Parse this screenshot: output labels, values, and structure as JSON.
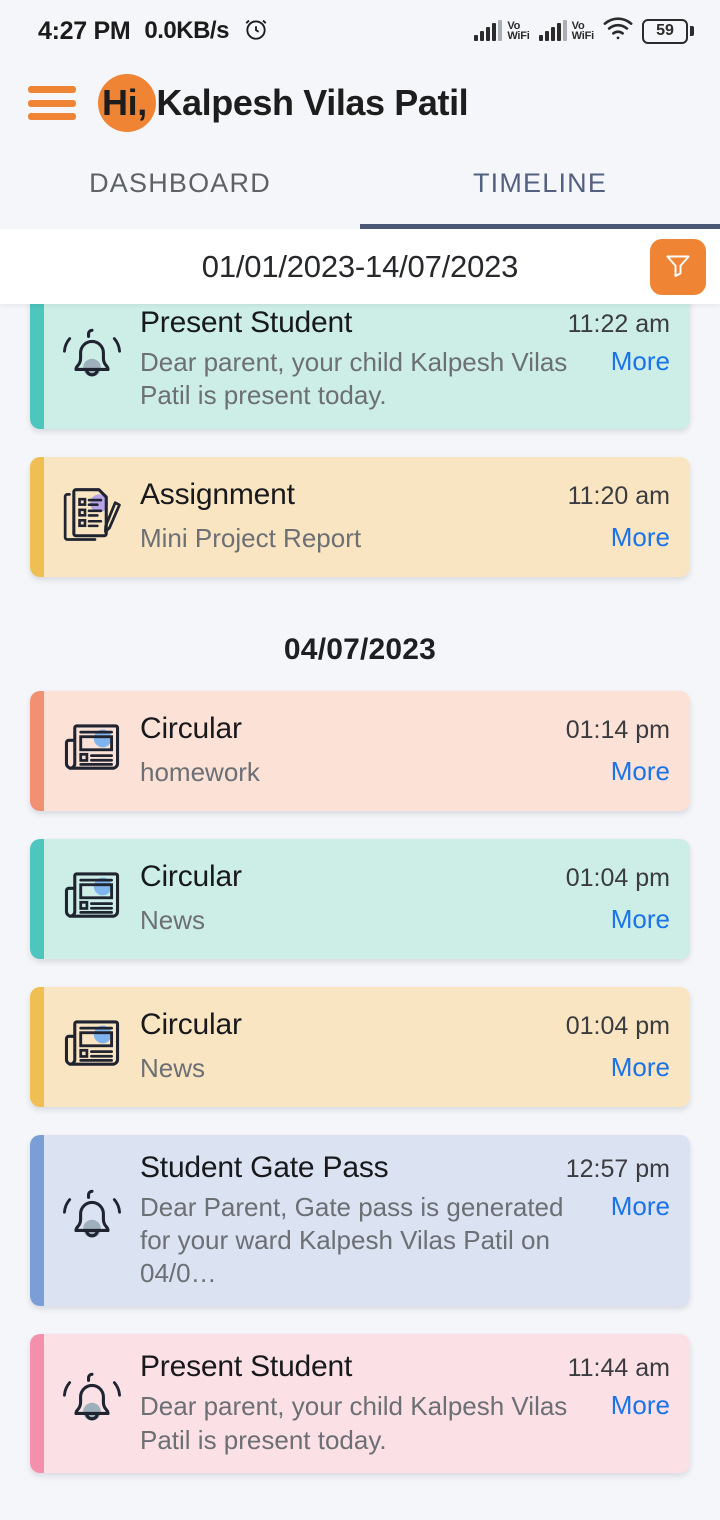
{
  "status_bar": {
    "time": "4:27 PM",
    "network_speed": "0.0KB/s",
    "alarm_icon": "alarm-clock-icon",
    "signal_1_icon": "cellular-signal-icon",
    "volte_1": "Vo\nWiFi",
    "volte_1_line1": "Vo",
    "volte_1_line2": "WiFi",
    "signal_2_icon": "cellular-signal-icon",
    "volte_2_line1": "Vo",
    "volte_2_line2": "WiFi",
    "wifi_icon": "wifi-icon",
    "battery_level": "59"
  },
  "app_bar": {
    "menu_icon": "hamburger-menu-icon",
    "avatar_label": "avatar",
    "greeting": "Hi, Kalpesh Vilas Patil"
  },
  "tabs": [
    {
      "label": "DASHBOARD",
      "active": false
    },
    {
      "label": "TIMELINE",
      "active": true
    }
  ],
  "filter": {
    "date_range": "01/01/2023-14/07/2023",
    "filter_icon": "funnel-filter-icon"
  },
  "timeline": {
    "groups": [
      {
        "date": null,
        "items": [
          {
            "icon": "bell-icon",
            "title": "Present Student",
            "time": "11:22 am",
            "description": "Dear parent, your child Kalpesh Vilas Patil is present today.",
            "more_label": "More",
            "accent_color": "#4ec5bd",
            "bg_color": "#cdeee7",
            "lines": 2
          },
          {
            "icon": "assignment-icon",
            "title": "Assignment",
            "time": "11:20 am",
            "description": "Mini Project Report",
            "more_label": "More",
            "accent_color": "#f0bf53",
            "bg_color": "#fae5c2",
            "lines": 1
          }
        ]
      },
      {
        "date": "04/07/2023",
        "items": [
          {
            "icon": "newspaper-icon",
            "title": "Circular",
            "time": "01:14 pm",
            "description": "homework",
            "more_label": "More",
            "accent_color": "#f29073",
            "bg_color": "#fce1d7",
            "lines": 1
          },
          {
            "icon": "newspaper-icon",
            "title": "Circular",
            "time": "01:04 pm",
            "description": "News",
            "more_label": "More",
            "accent_color": "#4ec5bd",
            "bg_color": "#cdeee7",
            "lines": 1
          },
          {
            "icon": "newspaper-icon",
            "title": "Circular",
            "time": "01:04 pm",
            "description": "News",
            "more_label": "More",
            "accent_color": "#f0bf53",
            "bg_color": "#fae5c2",
            "lines": 1
          },
          {
            "icon": "bell-icon",
            "title": "Student Gate Pass",
            "time": "12:57 pm",
            "description": "Dear Parent, Gate pass is generated for  your ward Kalpesh Vilas Patil on 04/0…",
            "more_label": "More",
            "accent_color": "#7c9ed6",
            "bg_color": "#dbe2f1",
            "lines": 2
          },
          {
            "icon": "bell-icon",
            "title": "Present Student",
            "time": "11:44 am",
            "description": "Dear parent, your child Kalpesh Vilas Patil is present today.",
            "more_label": "More",
            "accent_color": "#f490ac",
            "bg_color": "#fbe1e6",
            "lines": 2
          }
        ]
      }
    ]
  },
  "colors": {
    "brand_orange": "#ef8434",
    "tab_active": "#546080",
    "tab_indicator": "#4a5875",
    "link_blue": "#1a73e8",
    "page_bg": "#f5f6f9"
  }
}
